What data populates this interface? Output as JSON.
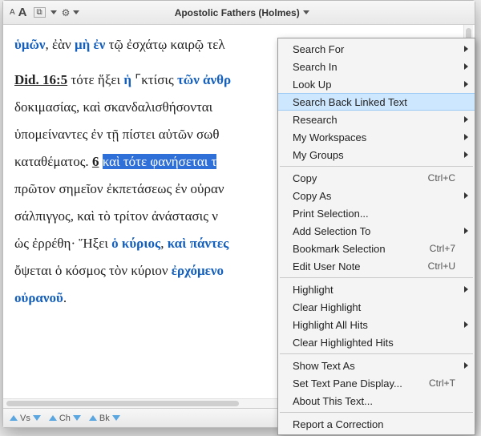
{
  "toolbar": {
    "small_a": "A",
    "big_a": "A",
    "title": "Apostolic Fathers (Holmes)"
  },
  "text": {
    "l1a": "ὑμῶν",
    "l1b": ", ἐὰν ",
    "l1c": "μὴ ἐν",
    "l1d": " τῷ ἐσχάτῳ καιρῷ τελ",
    "l2a": "Did. 16:5",
    "l2b": " τότε ἥξει ",
    "l2c": "ἡ",
    "l2d": " ⌜κτίσις ",
    "l2e": "τῶν ἀνθρ",
    "l3": "δοκιμασίας, καὶ σκανδαλισθήσονται ",
    "l4": "ὑπομείναντες ἐν τῇ πίστει αὐτῶν σωθ",
    "l5a": "καταθέματος. ",
    "l5n": "6",
    "l5b": " ",
    "l5sel": "καὶ τότε φανήσεται τ",
    "l6": "πρῶτον σημεῖον ἐκπετάσεως ἐν οὐραν",
    "l7": "σάλπιγγος, καὶ τὸ τρίτον ἀνάστασις ν",
    "l8a": "ὡς ἐρρέθη· Ἥξει ",
    "l8b": "ὁ κύριος",
    "l8c": ", ",
    "l8d": "καὶ πάντες ",
    "l9a": "ὄψεται ὁ κόσμος τὸν κύριον ",
    "l9b": "ἐρχόμενο",
    "l10": "οὐρανοῦ",
    "l10dot": "."
  },
  "menu": [
    {
      "type": "item",
      "label": "Search For",
      "sub": true
    },
    {
      "type": "item",
      "label": "Search In",
      "sub": true
    },
    {
      "type": "item",
      "label": "Look Up",
      "sub": true
    },
    {
      "type": "item",
      "label": "Search Back Linked Text",
      "hl": true
    },
    {
      "type": "item",
      "label": "Research",
      "sub": true
    },
    {
      "type": "item",
      "label": "My Workspaces",
      "sub": true
    },
    {
      "type": "item",
      "label": "My Groups",
      "sub": true
    },
    {
      "type": "sep"
    },
    {
      "type": "item",
      "label": "Copy",
      "shortcut": "Ctrl+C"
    },
    {
      "type": "item",
      "label": "Copy As",
      "sub": true
    },
    {
      "type": "item",
      "label": "Print Selection..."
    },
    {
      "type": "item",
      "label": "Add Selection To",
      "sub": true
    },
    {
      "type": "item",
      "label": "Bookmark Selection",
      "shortcut": "Ctrl+7"
    },
    {
      "type": "item",
      "label": "Edit User Note",
      "shortcut": "Ctrl+U"
    },
    {
      "type": "sep"
    },
    {
      "type": "item",
      "label": "Highlight",
      "sub": true
    },
    {
      "type": "item",
      "label": "Clear Highlight"
    },
    {
      "type": "item",
      "label": "Highlight All Hits",
      "sub": true
    },
    {
      "type": "item",
      "label": "Clear Highlighted Hits"
    },
    {
      "type": "sep"
    },
    {
      "type": "item",
      "label": "Show Text As",
      "sub": true
    },
    {
      "type": "item",
      "label": "Set Text Pane Display...",
      "shortcut": "Ctrl+T"
    },
    {
      "type": "item",
      "label": "About This Text..."
    },
    {
      "type": "sep"
    },
    {
      "type": "item",
      "label": "Report a Correction"
    }
  ],
  "footer": {
    "vs": "Vs",
    "ch": "Ch",
    "bk": "Bk"
  }
}
